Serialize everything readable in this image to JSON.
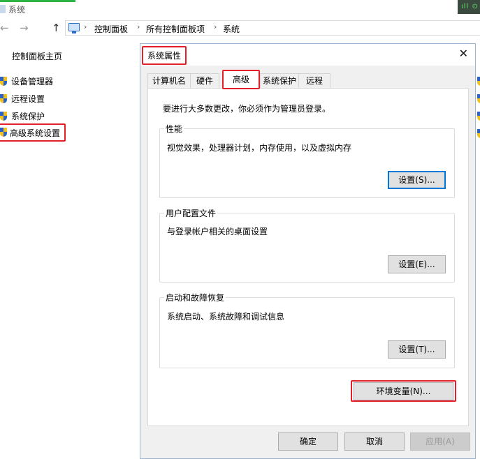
{
  "window": {
    "title": "系统",
    "net_widget": "ıll ⊙"
  },
  "addressbar": {
    "back_icon": "←",
    "forward_icon": "→",
    "up_icon": "↑",
    "crumbs": [
      "控制面板",
      "所有控制面板项",
      "系统"
    ],
    "separator": "›"
  },
  "sidebar": {
    "home": "控制面板主页",
    "items": [
      {
        "label": "设备管理器"
      },
      {
        "label": "远程设置"
      },
      {
        "label": "系统保护"
      },
      {
        "label": "高级系统设置"
      }
    ]
  },
  "dialog": {
    "title": "系统属性",
    "close": "✕",
    "tabs": [
      "计算机名",
      "硬件",
      "高级",
      "系统保护",
      "远程"
    ],
    "active_tab": "高级",
    "admin_note": "要进行大多数更改，你必须作为管理员登录。",
    "groups": {
      "performance": {
        "legend": "性能",
        "desc": "视觉效果，处理器计划，内存使用，以及虚拟内存",
        "button": "设置(S)..."
      },
      "user_profiles": {
        "legend": "用户配置文件",
        "desc": "与登录帐户相关的桌面设置",
        "button": "设置(E)..."
      },
      "startup_recovery": {
        "legend": "启动和故障恢复",
        "desc": "系统启动、系统故障和调试信息",
        "button": "设置(T)..."
      }
    },
    "env_button": "环境变量(N)...",
    "footer": {
      "ok": "确定",
      "cancel": "取消",
      "apply": "应用(A)"
    }
  },
  "colors": {
    "highlight_red": "#e3202a",
    "focus_blue": "#0078d7"
  }
}
